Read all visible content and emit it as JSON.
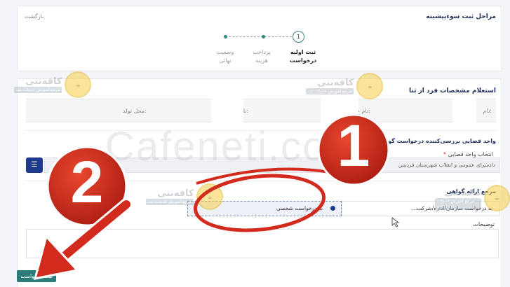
{
  "header": {
    "title": "مراحل ثبت سوءپیشینه",
    "back_label": "بازگشت"
  },
  "steps": [
    {
      "number": "1",
      "label_line1": "ثبت اولیه",
      "label_line2": "درخواست",
      "active": true
    },
    {
      "label_line1": "پرداخت",
      "label_line2": "هزینه",
      "active": false
    },
    {
      "label_line1": "وضعیت",
      "label_line2": "نهائی",
      "active": false
    }
  ],
  "identity": {
    "section_title": "استعلام مشخصات فرد از ثنا",
    "name_label": "نام:",
    "surname_label": "نام خانوادگی:",
    "father_label": "نام پدر:",
    "birthplace_label": "محل تولد:"
  },
  "judicial": {
    "section_title": "واحد قضایی بررسی‌کننده درخواست گواهی عدم سو...",
    "select_label": "انتخاب واحد قضایی",
    "required_mark": "*",
    "select_value": "دادسرای عمومی و انقلاب شهرستان فردیس"
  },
  "reference": {
    "section_title": "مرجع ارائه گواهی",
    "option_personal": "به درخواست شخصی",
    "option_org": "به درخواست سازمان/اداره/شرکت..."
  },
  "description": {
    "label": "توضیحات",
    "value": ""
  },
  "submit_label": "ثبت درخواست",
  "watermark": {
    "text": "Cafeneti.com",
    "brand": "کافه‌نتی",
    "tagline": "مرجع آموزش خدمات نت"
  },
  "overlay": {
    "badge_1": "1",
    "badge_2": "2"
  },
  "colors": {
    "primary": "#1e3a8a",
    "teal": "#2d7c7a",
    "red": "#d32a1e",
    "step": "#2e8b7a"
  }
}
